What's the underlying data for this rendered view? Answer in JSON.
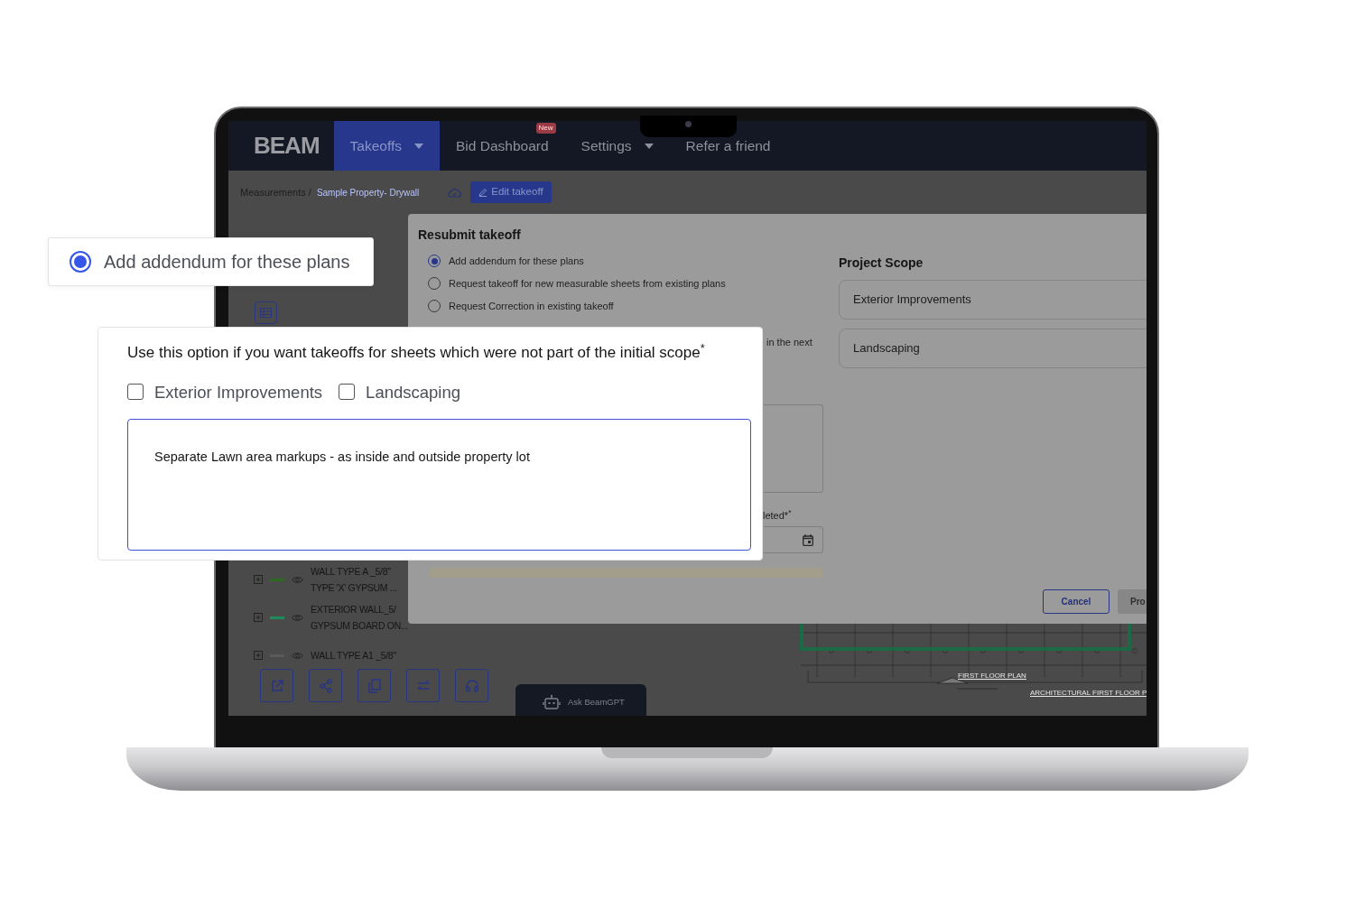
{
  "nav": {
    "logo": "BEAM",
    "items": [
      {
        "label": "Takeoffs",
        "dropdown": true,
        "selected": true
      },
      {
        "label": "Bid Dashboard",
        "dropdown": false,
        "selected": false,
        "badge": "New"
      },
      {
        "label": "Settings",
        "dropdown": true,
        "selected": false
      },
      {
        "label": "Refer a friend",
        "dropdown": false,
        "selected": false
      }
    ]
  },
  "breadcrumb": {
    "parent": "Measurements /",
    "current": "Sample Property- Drywall"
  },
  "edit_button": "Edit takeoff",
  "sidebar": {
    "layers": [
      {
        "lines": [
          "WALL TYPE A _5/8\"",
          "TYPE 'X' GYPSUM ..."
        ],
        "color": "#2d6a1f"
      },
      {
        "lines": [
          "EXTERIOR WALL_5/",
          "GYPSUM BOARD ON..."
        ],
        "color": "#1f8a5c"
      },
      {
        "lines": [
          "WALL TYPE A1 _5/8\""
        ],
        "color": "#5a5a5a"
      }
    ]
  },
  "modal": {
    "title": "Resubmit takeoff",
    "options": [
      {
        "label": "Add addendum for these plans",
        "selected": true
      },
      {
        "label": "Request takeoff for new measurable sheets from existing plans",
        "selected": false
      },
      {
        "label": "Request Correction in existing takeoff",
        "selected": false
      }
    ],
    "partial_text": "in the next",
    "scope_title": "Project Scope",
    "scope_items": [
      "Exterior Improvements",
      "Landscaping"
    ],
    "date_label": "leted*$^{*}$",
    "buttons": [
      {
        "label": "Cancel",
        "kind": "outline"
      },
      {
        "label": "Pro",
        "kind": "disabled"
      }
    ]
  },
  "ask_button": "Ask BeamGPT",
  "floor_plan": {
    "title": "FIRST FLOOR PLAN",
    "sheet_label": "ARCHITECTURAL FIRST FLOOR P"
  },
  "callouts": {
    "option": {
      "label": "Add addendum for these plans",
      "selected": true
    },
    "scope_prompt": "Use this option if you want takeoffs for sheets which were not part of the initial scope$^{*}$",
    "checkboxes": [
      {
        "label": "Exterior Improvements",
        "checked": false
      },
      {
        "label": "Landscaping",
        "checked": false
      }
    ],
    "notes_value": "Separate Lawn area markups - as inside and outside property lot"
  }
}
